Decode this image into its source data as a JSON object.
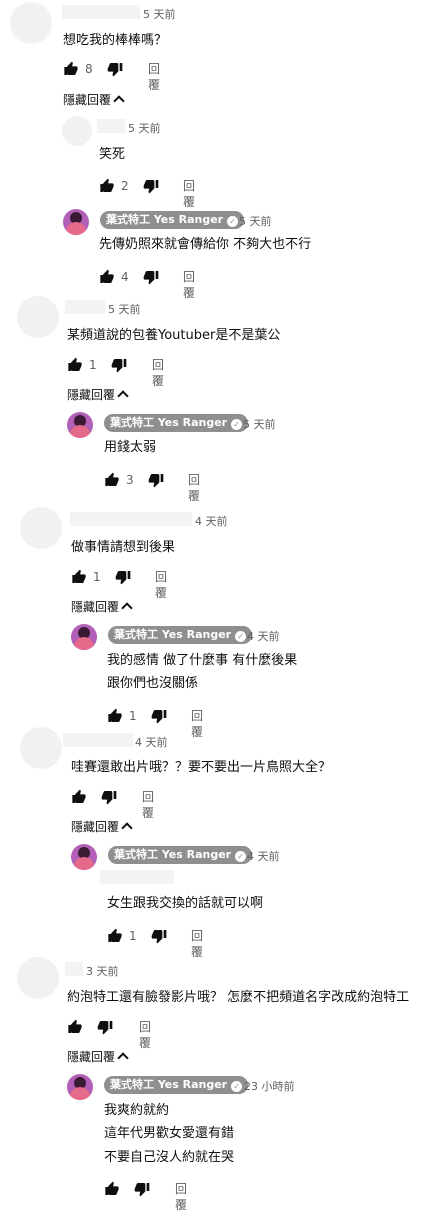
{
  "owner_name": "葉式特工 Yes Ranger",
  "reply_label": "回覆",
  "hide_label": "隱藏回覆",
  "threads": [
    {
      "comment": {
        "time": "5 天前",
        "text": "想吃我的棒棒嗎？",
        "likes": "8"
      },
      "replies": [
        {
          "time": "5 天前",
          "text": "笑死",
          "likes": "2"
        },
        {
          "time": "5 天前",
          "text": "先傳奶照來就會傳給你 不夠大也不行",
          "likes": "4"
        }
      ]
    },
    {
      "comment": {
        "time": "5 天前",
        "text": "某頻道說的包養Youtuber是不是葉公",
        "likes": "1"
      },
      "replies": [
        {
          "time": "5 天前",
          "text": "用錢太弱",
          "likes": "3"
        }
      ]
    },
    {
      "comment": {
        "time": "4 天前",
        "text": "做事情請想到後果",
        "likes": "1"
      },
      "replies": [
        {
          "time": "4 天前",
          "text1": "我的感情 做了什麼事 有什麼後果",
          "text2": "跟你們也沒關係",
          "likes": "1"
        }
      ]
    },
    {
      "comment": {
        "time": "4 天前",
        "text": "哇賽還敢出片哦？？要不要出一片鳥照大全？",
        "likes": ""
      },
      "replies": [
        {
          "time": "4 天前",
          "text": "女生跟我交換的話就可以啊",
          "likes": "1"
        }
      ]
    },
    {
      "comment": {
        "time": "3 天前",
        "text": "約泡特工還有臉發影片哦？ 怎麼不把頻道名字改成約泡特工",
        "likes": ""
      },
      "replies": [
        {
          "time": "23 小時前",
          "text1": "我爽約就約",
          "text2": "這年代男歡女愛還有錯",
          "text3": "不要自己沒人約就在哭",
          "likes": ""
        }
      ]
    }
  ]
}
